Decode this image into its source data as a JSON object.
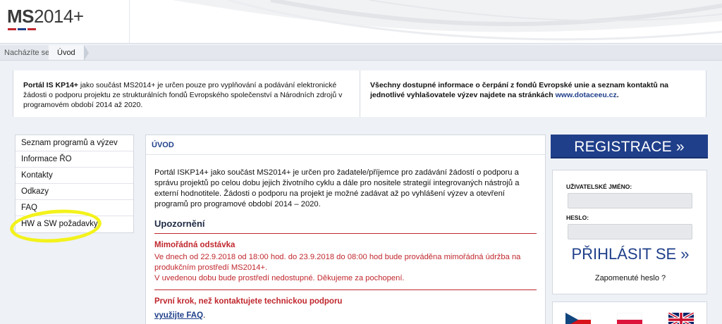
{
  "logo": {
    "text_bold": "MS",
    "text_regular": "2014+",
    "flag_colors": [
      "#c0272d",
      "#1f3f8a",
      "#1f3f8a"
    ]
  },
  "breadcrumb": {
    "label": "Nacházíte se:",
    "current": "Úvod"
  },
  "info": {
    "left_bold": "Portál IS KP14+",
    "left_text": " jako součást MS2014+ je určen pouze pro vyplňování a podávání elektronické žádosti o podporu projektu ze strukturálních fondů Evropského společenství a Národních zdrojů v programovém období 2014 až 2020.",
    "right_text": "Všechny dostupné informace o čerpání z fondů Evropské unie a seznam kontaktů na jednotlivé vyhlašovatele výzev najdete na stránkách ",
    "right_link": "www.dotaceeu.cz",
    "right_end": "."
  },
  "nav": [
    {
      "label": "Seznam programů a výzev"
    },
    {
      "label": "Informace ŘO"
    },
    {
      "label": "Kontakty"
    },
    {
      "label": "Odkazy"
    },
    {
      "label": "FAQ"
    },
    {
      "label": "HW a SW požadavky"
    }
  ],
  "main": {
    "heading": "ÚVOD",
    "intro": "Portál ISKP14+ jako součást MS2014+ je určen pro žadatele/příjemce pro zadávání žádostí o podporu a správu projektů po celou dobu jejich životního cyklu a dále pro nositele strategií integrovaných nástrojů a externí hodnotitele. Žádosti o podporu na projekt je možné zadávat až po vyhlášení výzev a otevření programů pro programové období 2014 – 2020.",
    "warning_title": "Upozornění",
    "section1_title": "Mimořádná odstávka",
    "section1_line1": "Ve dnech od 22.9.2018 od 18:00 hod. do 23.9.2018 do 08:00 hod bude prováděna mimořádná údržba na produkčním prostředí MS2014+.",
    "section1_line2": "V uvedenou dobu bude prostředí nedostupné. Děkujeme za pochopení.",
    "section2_title": "První krok, než kontaktujete technickou podporu",
    "section2_link": "využijte FAQ",
    "section2_end": "."
  },
  "right": {
    "register_label": "REGISTRACE »",
    "username_label": "UŽIVATELSKÉ JMÉNO:",
    "password_label": "HESLO:",
    "login_label": "PŘIHLÁSIT SE »",
    "forgot_label": "Zapomenuté heslo ?"
  },
  "languages": [
    {
      "name": "czech-flag-icon"
    },
    {
      "name": "polish-flag-icon"
    },
    {
      "name": "uk-flag-icon"
    }
  ],
  "colors": {
    "brand_blue": "#1f3f8a",
    "alert_red": "#c0272d",
    "highlight_yellow": "#f3f21c"
  }
}
